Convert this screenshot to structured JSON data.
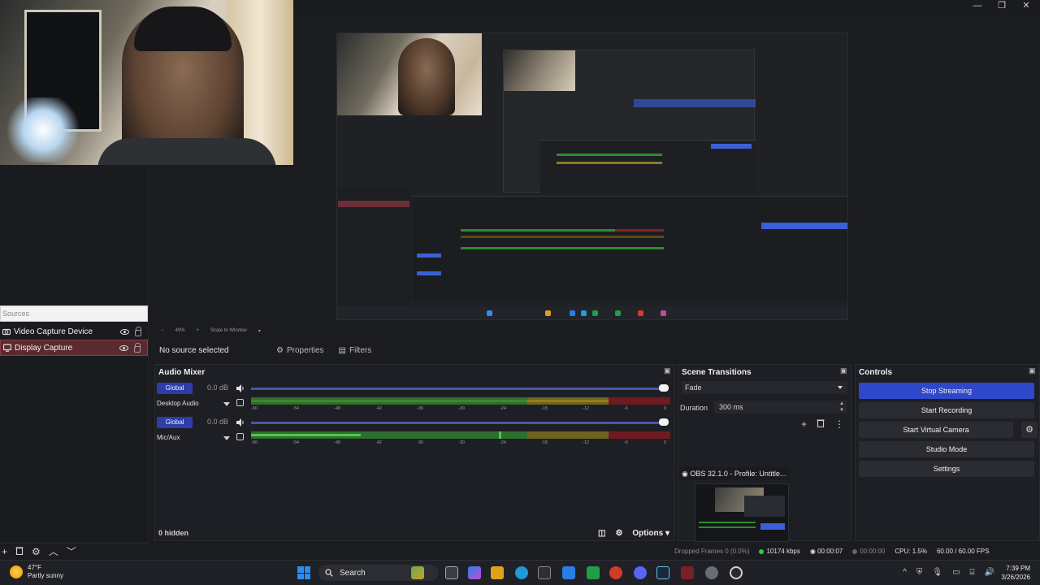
{
  "window": {
    "controls": [
      "—",
      "❐",
      "✕"
    ]
  },
  "preview": {
    "scale_label": "49%",
    "scale_mode": "Scale to Window"
  },
  "sources": {
    "header": "Sources",
    "items": [
      {
        "label": "Video Capture Device",
        "icon": "camera-icon",
        "selected": false
      },
      {
        "label": "Display Capture",
        "icon": "monitor-icon",
        "selected": true
      }
    ]
  },
  "context_bar": {
    "no_source": "No source selected",
    "properties": "Properties",
    "filters": "Filters"
  },
  "audio_mixer": {
    "title": "Audio Mixer",
    "channels": [
      {
        "badge": "Global",
        "db": "0.0 dB",
        "name": "Desktop Audio"
      },
      {
        "badge": "Global",
        "db": "0.0 dB",
        "name": "Mic/Aux"
      }
    ],
    "ticks": [
      "-60",
      "-54",
      "-48",
      "-42",
      "-36",
      "-30",
      "-24",
      "-18",
      "-12",
      "-6",
      "0"
    ],
    "hidden": "0 hidden",
    "options": "Options"
  },
  "scene_transitions": {
    "title": "Scene Transitions",
    "transition": "Fade",
    "duration_label": "Duration",
    "duration_value": "300 ms",
    "tooltip": "OBS 32.1.0 - Profile: Untitle..."
  },
  "controls": {
    "title": "Controls",
    "stop_streaming": "Stop Streaming",
    "start_recording": "Start Recording",
    "start_virtual_camera": "Start Virtual Camera",
    "studio_mode": "Studio Mode",
    "settings": "Settings"
  },
  "status": {
    "dropped": "Dropped Frames 0 (0.0%)",
    "bitrate": "10174 kbps",
    "stream_time": "00:00:07",
    "rec_time": "00:00:00",
    "cpu": "CPU: 1.5%",
    "fps": "60.00 / 60.00 FPS"
  },
  "taskbar": {
    "temperature": "47°F",
    "condition": "Partly sunny",
    "search": "Search",
    "time": "7:39 PM",
    "date": "3/26/2026"
  },
  "colors": {
    "accent": "#2f48c9",
    "selected_source": "#5b2a30",
    "meter_green": "#2e8b2e",
    "meter_yellow": "#8a7a20",
    "meter_red": "#8a1f25"
  }
}
